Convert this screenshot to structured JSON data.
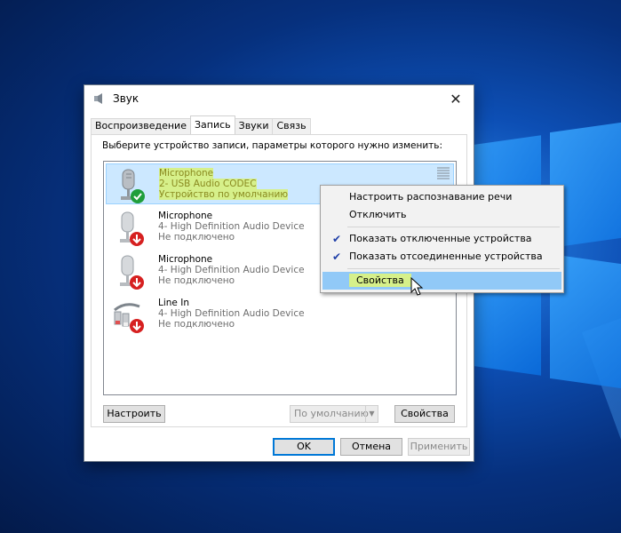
{
  "window": {
    "title": "Звук"
  },
  "tabs": [
    "Воспроизведение",
    "Запись",
    "Звуки",
    "Связь"
  ],
  "instruction": "Выберите устройство записи, параметры которого нужно изменить:",
  "devices": [
    {
      "name": "Microphone",
      "desc": "2- USB Audio CODEC",
      "state": "Устройство по умолчанию",
      "icon": "microphone-default-icon"
    },
    {
      "name": "Microphone",
      "desc": "4- High Definition Audio Device",
      "state": "Не подключено",
      "icon": "microphone-unplugged-icon"
    },
    {
      "name": "Microphone",
      "desc": "4- High Definition Audio Device",
      "state": "Не подключено",
      "icon": "microphone-unplugged-icon"
    },
    {
      "name": "Line In",
      "desc": "4- High Definition Audio Device",
      "state": "Не подключено",
      "icon": "line-in-unplugged-icon"
    }
  ],
  "buttons": {
    "configure": "Настроить",
    "default": "По умолчанию",
    "properties": "Свойства",
    "ok": "OK",
    "cancel": "Отмена",
    "apply": "Применить"
  },
  "context_menu": {
    "items": [
      "Настроить распознавание речи",
      "Отключить",
      "Показать отключенные устройства",
      "Показать отсоединенные устройства",
      "Свойства"
    ],
    "checked": [
      false,
      false,
      true,
      true,
      false
    ]
  },
  "colors": {
    "selection": "#cce8ff",
    "highlight": "#d6f08a",
    "accent": "#0078d7"
  }
}
